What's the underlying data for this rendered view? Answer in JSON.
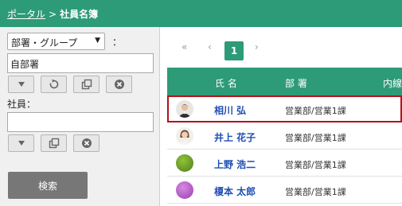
{
  "breadcrumb": {
    "parent": "ポータル",
    "separator": ">",
    "current": "社員名簿"
  },
  "sidebar": {
    "group_select": "部署・グループ",
    "colon": "：",
    "dept_value": "自部署",
    "employee_label": "社員：",
    "employee_value": "",
    "search_button": "検索"
  },
  "pager": {
    "first": "«",
    "prev": "‹",
    "current": "1",
    "next": "›"
  },
  "table": {
    "headers": {
      "name": "氏 名",
      "dept": "部 署",
      "extra": "内線"
    },
    "rows": [
      {
        "name": "相川 弘",
        "dept": "営業部/営業1課",
        "avatar": "person-photo",
        "highlighted": true
      },
      {
        "name": "井上 花子",
        "dept": "営業部/営業1課",
        "avatar": "person-photo",
        "highlighted": false
      },
      {
        "name": "上野 浩二",
        "dept": "営業部/営業1課",
        "avatar": "green-circle",
        "highlighted": false
      },
      {
        "name": "榎本 太郎",
        "dept": "営業部/営業1課",
        "avatar": "purple-circle",
        "highlighted": false
      }
    ]
  },
  "colors": {
    "brand": "#2d9b77",
    "link": "#1f4eb3",
    "highlight": "#b3121b"
  },
  "icons": [
    "dropdown-arrow-icon",
    "reset-icon",
    "copy-icon",
    "clear-icon"
  ]
}
